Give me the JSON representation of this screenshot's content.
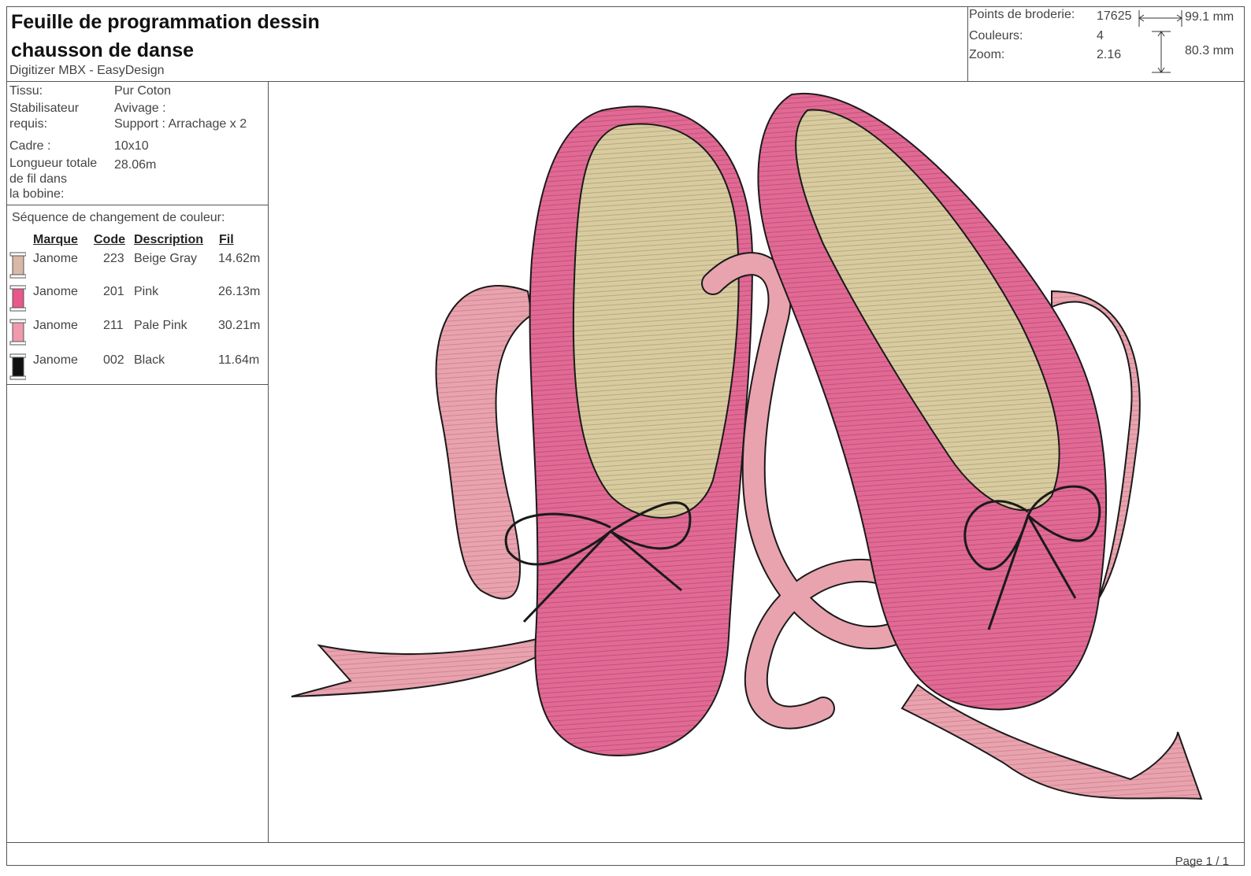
{
  "header": {
    "title_line1": "Feuille de programmation dessin",
    "title_line2": "chausson de danse",
    "software": "Digitizer MBX - EasyDesign"
  },
  "stats": {
    "points_label": "Points de broderie:",
    "points_value": "17625",
    "colors_label": "Couleurs:",
    "colors_value": "4",
    "zoom_label": "Zoom:",
    "zoom_value": "2.16",
    "width": "99.1 mm",
    "height": "80.3 mm"
  },
  "fabric": {
    "tissu_label": "Tissu:",
    "tissu_value": "Pur Coton",
    "stab_label_1": "Stabilisateur",
    "stab_label_2": "requis:",
    "avivage": "Avivage :",
    "support": "Support : Arrachage x 2",
    "cadre_label": "Cadre :",
    "cadre_value": "10x10",
    "length_label_1": "Longueur totale",
    "length_label_2": "de fil dans",
    "length_label_3": "la bobine:",
    "length_value": "28.06m"
  },
  "sequence": {
    "title": "Séquence de changement de couleur:",
    "headers": {
      "marque": "Marque",
      "code": "Code",
      "description": "Description",
      "fil": "Fil"
    },
    "rows": [
      {
        "marque": "Janome",
        "code": "223",
        "description": "Beige Gray",
        "fil": "14.62m",
        "color": "#d9b8a8"
      },
      {
        "marque": "Janome",
        "code": "201",
        "description": "Pink",
        "fil": "26.13m",
        "color": "#e8588a"
      },
      {
        "marque": "Janome",
        "code": "211",
        "description": "Pale Pink",
        "fil": "30.21m",
        "color": "#f09aae"
      },
      {
        "marque": "Janome",
        "code": "002",
        "description": "Black",
        "fil": "11.64m",
        "color": "#111111"
      }
    ]
  },
  "footer": {
    "page": "Page 1 / 1"
  },
  "colors": {
    "shoe_pink": "#e06a94",
    "ribbon_pink": "#e8a3ae",
    "sole_beige": "#d8cba0",
    "outline": "#1a1a1a"
  }
}
